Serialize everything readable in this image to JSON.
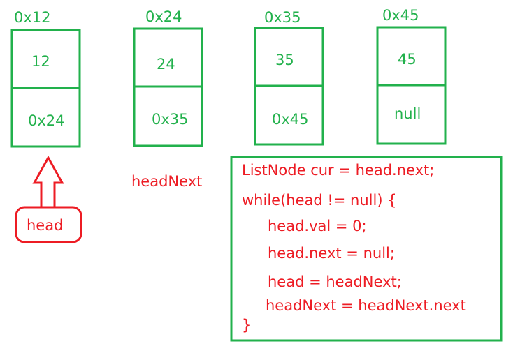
{
  "colors": {
    "node": "#22b14c",
    "code": "#ed1c24"
  },
  "nodes": [
    {
      "address": "0x12",
      "val": "12",
      "next": "0x24"
    },
    {
      "address": "0x24",
      "val": "24",
      "next": "0x35"
    },
    {
      "address": "0x35",
      "val": "35",
      "next": "0x45"
    },
    {
      "address": "0x45",
      "val": "45",
      "next": "null"
    }
  ],
  "pointers": {
    "head": "head",
    "headNext": "headNext",
    "head_arrow_icon": "arrow-up-icon"
  },
  "code": [
    "ListNode cur = head.next;",
    "while(head != null) {",
    "head.val = 0;",
    "head.next = null;",
    "head = headNext;",
    "headNext = headNext.next",
    "}"
  ]
}
